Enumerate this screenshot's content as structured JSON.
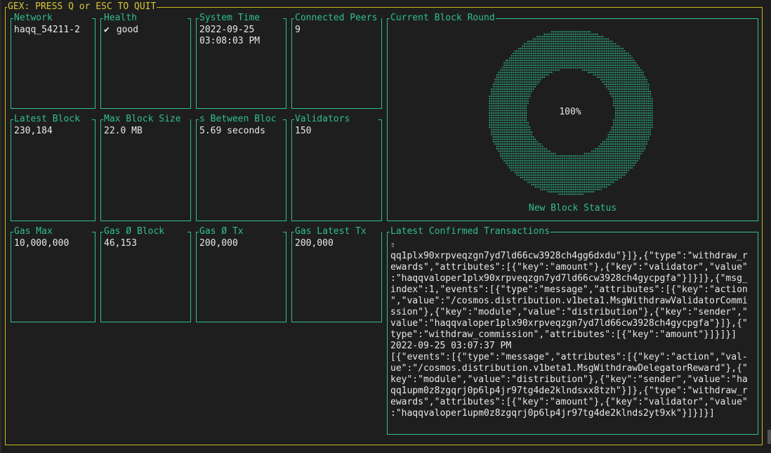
{
  "window": {
    "title": "GEX: PRESS Q or ESC TO QUIT"
  },
  "colors": {
    "frame": "#c9b71a",
    "box": "#2fbf8f",
    "text": "#e8e8e8",
    "background": "#1e1e1e"
  },
  "row1": {
    "network": {
      "title": "Network",
      "value": "haqq_54211-2"
    },
    "health": {
      "title": "Health",
      "icon": "check-icon",
      "check": "✔",
      "value": "good"
    },
    "system_time": {
      "title": "System Time",
      "date": "2022-09-25",
      "time": "03:08:03 PM"
    },
    "connected_peers": {
      "title": "Connected Peers",
      "value": "9"
    }
  },
  "row2": {
    "latest_block": {
      "title": "Latest Block",
      "value": "230,184"
    },
    "max_block_size": {
      "title": "Max Block Size",
      "value": "22.0 MB"
    },
    "s_between_blocks": {
      "title": "s Between Bloc",
      "value": "5.69 seconds"
    },
    "validators": {
      "title": "Validators",
      "value": "150"
    }
  },
  "row3": {
    "gas_max": {
      "title": "Gas Max",
      "value": "10,000,000"
    },
    "gas_block": {
      "title": "Gas Ø Block",
      "value": "46,153"
    },
    "gas_tx": {
      "title": "Gas Ø Tx",
      "value": "200,000"
    },
    "gas_latest_tx": {
      "title": "Gas Latest Tx",
      "value": "200,000"
    }
  },
  "block_round": {
    "title": "Current Block Round",
    "percent": "100%",
    "progress": 1.0,
    "label": "New Block Status"
  },
  "transactions": {
    "title": "Latest Confirmed Transactions",
    "scroll_marker": "⇧",
    "lines": [
      "qq1plx90xrpveqzgn7yd7ld66cw3928ch4gg6dxdu\"}]},{\"type\":\"withdraw_r",
      "ewards\",\"attributes\":[{\"key\":\"amount\"},{\"key\":\"validator\",\"value\"",
      ":\"haqqvaloper1plx90xrpveqzgn7yd7ld66cw3928ch4gycpgfa\"}]}]},{\"msg_",
      "index\":1,\"events\":[{\"type\":\"message\",\"attributes\":[{\"key\":\"action",
      "\",\"value\":\"/cosmos.distribution.v1beta1.MsgWithdrawValidatorCommi",
      "ssion\"},{\"key\":\"module\",\"value\":\"distribution\"},{\"key\":\"sender\",\"",
      "value\":\"haqqvaloper1plx90xrpveqzgn7yd7ld66cw3928ch4gycpgfa\"}]},{\"",
      "type\":\"withdraw_commission\",\"attributes\":[{\"key\":\"amount\"}]}]}]",
      "2022-09-25 03:07:37 PM",
      "[{\"events\":[{\"type\":\"message\",\"attributes\":[{\"key\":\"action\",\"val-",
      "ue\":\"/cosmos.distribution.v1beta1.MsgWithdrawDelegatorReward\"},{\"",
      "key\":\"module\",\"value\":\"distribution\"},{\"key\":\"sender\",\"value\":\"ha",
      "qq1upm0z8zgqrj0p6lp4jr97tg4de2klndsxx8tzh\"}]},{\"type\":\"withdraw_r",
      "ewards\",\"attributes\":[{\"key\":\"amount\"},{\"key\":\"validator\",\"value\"",
      ":\"haqqvaloper1upm0z8zgqrj0p6lp4jr97tg4de2klnds2yt9xk\"}]}]}]"
    ]
  }
}
